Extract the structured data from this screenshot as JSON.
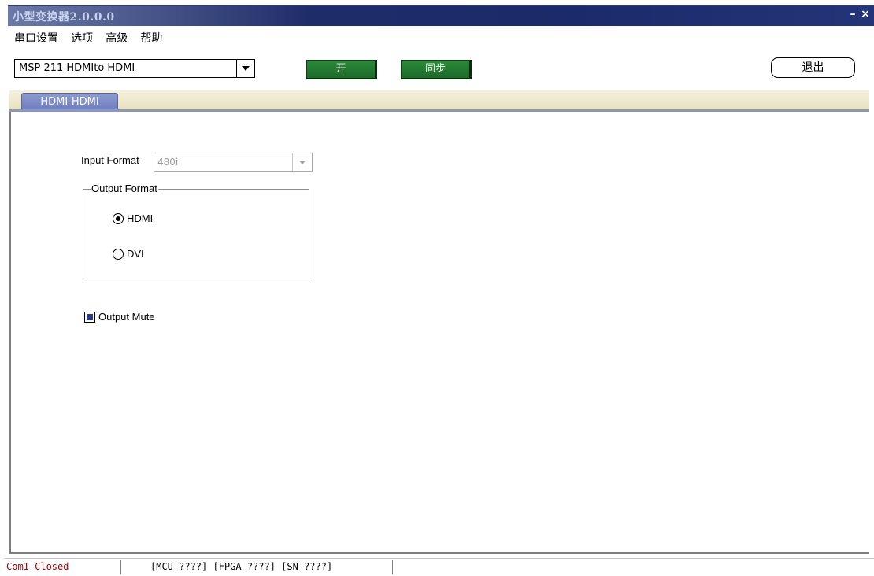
{
  "window": {
    "title": "小型变换器2.0.0.0",
    "minimize_label": "–",
    "close_label": "×"
  },
  "menu": [
    "串口设置",
    "选项",
    "高级",
    "帮助"
  ],
  "toolbar": {
    "device_select": "MSP 211 HDMIto HDMI",
    "open_label": "开",
    "sync_label": "同步",
    "exit_label": "退出"
  },
  "tabs": [
    {
      "label": "HDMI-HDMI",
      "active": true
    }
  ],
  "form": {
    "input_format_label": "Input Format",
    "input_format_value": "480i",
    "output_format_legend": "Output Format",
    "output_options": [
      {
        "label": "HDMI",
        "checked": true
      },
      {
        "label": "DVI",
        "checked": false
      }
    ],
    "output_mute_label": "Output Mute",
    "output_mute_checked": true
  },
  "status": {
    "port": "Com1 Closed",
    "versions": "[MCU-????] [FPGA-????] [SN-????]",
    "port_color": "#b00000"
  }
}
